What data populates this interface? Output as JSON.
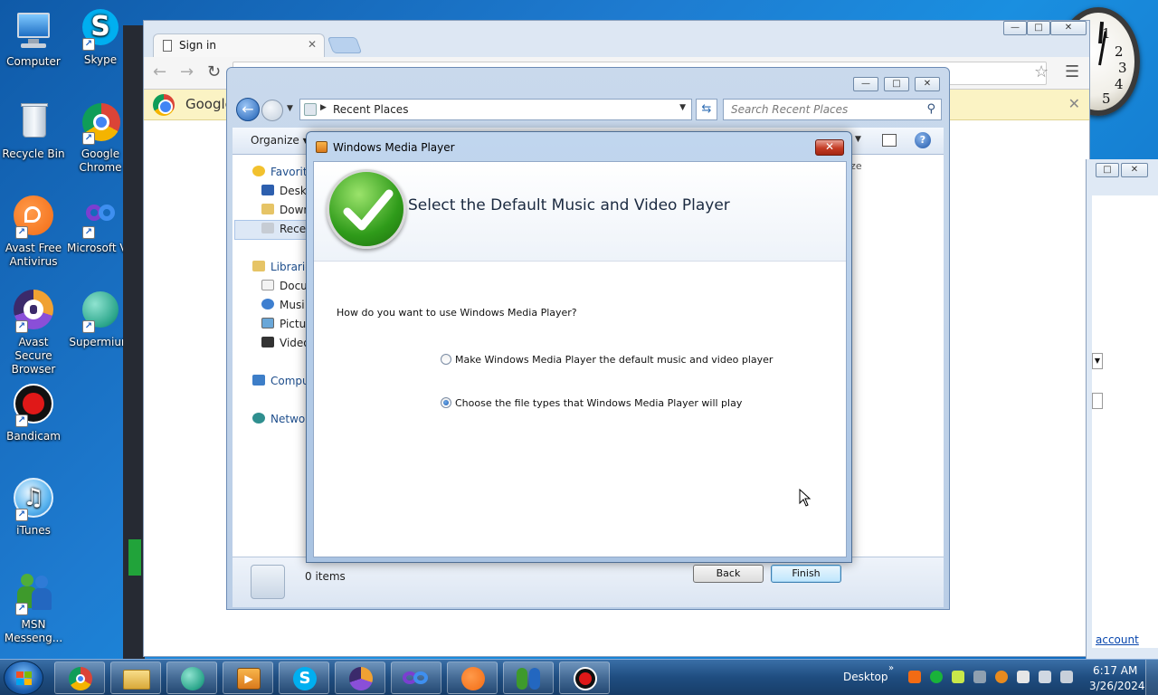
{
  "desktop": {
    "icons": [
      {
        "label": "Computer"
      },
      {
        "label": "Skype"
      },
      {
        "label": "Recycle Bin"
      },
      {
        "label": "Google Chrome"
      },
      {
        "label": "Avast Free Antivirus"
      },
      {
        "label": "Microsoft Visual Studi"
      },
      {
        "label": "Avast Secure Browser"
      },
      {
        "label": "Supermium"
      },
      {
        "label": "Bandicam"
      },
      {
        "label": "iTunes"
      },
      {
        "label": "MSN Messeng..."
      }
    ]
  },
  "chrome": {
    "tab_title": "Sign in",
    "infobar_text": "Google",
    "controls": {
      "minimize": "—",
      "maximize": "□",
      "close": "✕"
    }
  },
  "right_window": {
    "link_text": "account"
  },
  "explorer": {
    "address": "Recent Places",
    "search_placeholder": "Search Recent Places",
    "organize_label": "Organize",
    "column_partial": "ize",
    "nav": {
      "favorites": "Favorit",
      "desktop": "Deskt",
      "downloads": "Down",
      "recent": "Recen",
      "libraries": "Librarie",
      "documents": "Docu",
      "music": "Musi",
      "pictures": "Pictu",
      "videos": "Video",
      "computer": "Compu",
      "network": "Networ"
    },
    "status_count": "0 items"
  },
  "dialog": {
    "title": "Windows Media Player",
    "heading": "Select the Default Music and Video Player",
    "question": "How do you want to use Windows Media Player?",
    "options": [
      {
        "label": "Make Windows Media Player the default music and video player",
        "selected": false
      },
      {
        "label": "Choose the file types that Windows Media Player will play",
        "selected": true
      }
    ],
    "back_label": "Back",
    "finish_label": "Finish"
  },
  "taskbar": {
    "desktop_label": "Desktop",
    "time": "6:17 AM",
    "date": "3/26/2024"
  },
  "colors": {
    "desktop_bg": "#1a7bd0",
    "dialog_frame": "#a9c3e2",
    "close_red": "#c43b24",
    "link": "#0645ad"
  }
}
